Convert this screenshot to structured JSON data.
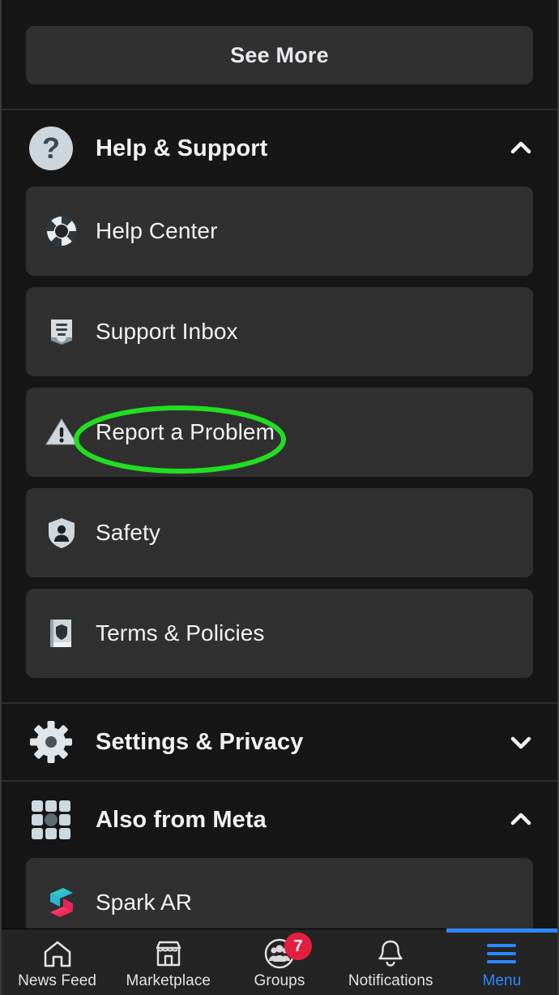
{
  "screen": {
    "app": "Facebook",
    "theme": "dark",
    "accent_color": "#2d88ff",
    "page_background": "#161616",
    "card_background": "#303030",
    "badge_color": "#e41e3f",
    "annotation_color": "#22dd22"
  },
  "see_more": {
    "label": "See More",
    "icon": "see-more-button"
  },
  "sections": [
    {
      "id": "help-support",
      "title": "Help & Support",
      "icon": "question-mark-circle-icon",
      "chevron": "chevron-up-icon",
      "expanded": true,
      "items": [
        {
          "label": "Help Center",
          "icon": "life-ring-icon"
        },
        {
          "label": "Support Inbox",
          "icon": "inbox-tray-icon"
        },
        {
          "label": "Report a Problem",
          "icon": "warning-triangle-icon",
          "annotated": true
        },
        {
          "label": "Safety",
          "icon": "shield-person-icon"
        },
        {
          "label": "Terms & Policies",
          "icon": "book-shield-icon"
        }
      ]
    },
    {
      "id": "settings-privacy",
      "title": "Settings & Privacy",
      "icon": "gear-icon",
      "chevron": "chevron-down-icon",
      "expanded": false,
      "items": []
    },
    {
      "id": "also-from-meta",
      "title": "Also from Meta",
      "icon": "app-grid-icon",
      "chevron": "chevron-up-icon",
      "expanded": true,
      "items": [
        {
          "label": "Spark AR",
          "icon": "spark-ar-logo-icon"
        }
      ]
    }
  ],
  "annotation": {
    "target": "Report a Problem",
    "shape": "ellipse",
    "color": "#22dd22",
    "stroke_width": 6
  },
  "bottom_nav": {
    "items": [
      {
        "label": "News Feed",
        "icon": "home-icon",
        "active": false,
        "badge": ""
      },
      {
        "label": "Marketplace",
        "icon": "storefront-icon",
        "active": false,
        "badge": ""
      },
      {
        "label": "Groups",
        "icon": "groups-icon",
        "active": false,
        "badge": "7"
      },
      {
        "label": "Notifications",
        "icon": "bell-icon",
        "active": false,
        "badge": ""
      },
      {
        "label": "Menu",
        "icon": "hamburger-menu-icon",
        "active": true,
        "badge": ""
      }
    ]
  }
}
